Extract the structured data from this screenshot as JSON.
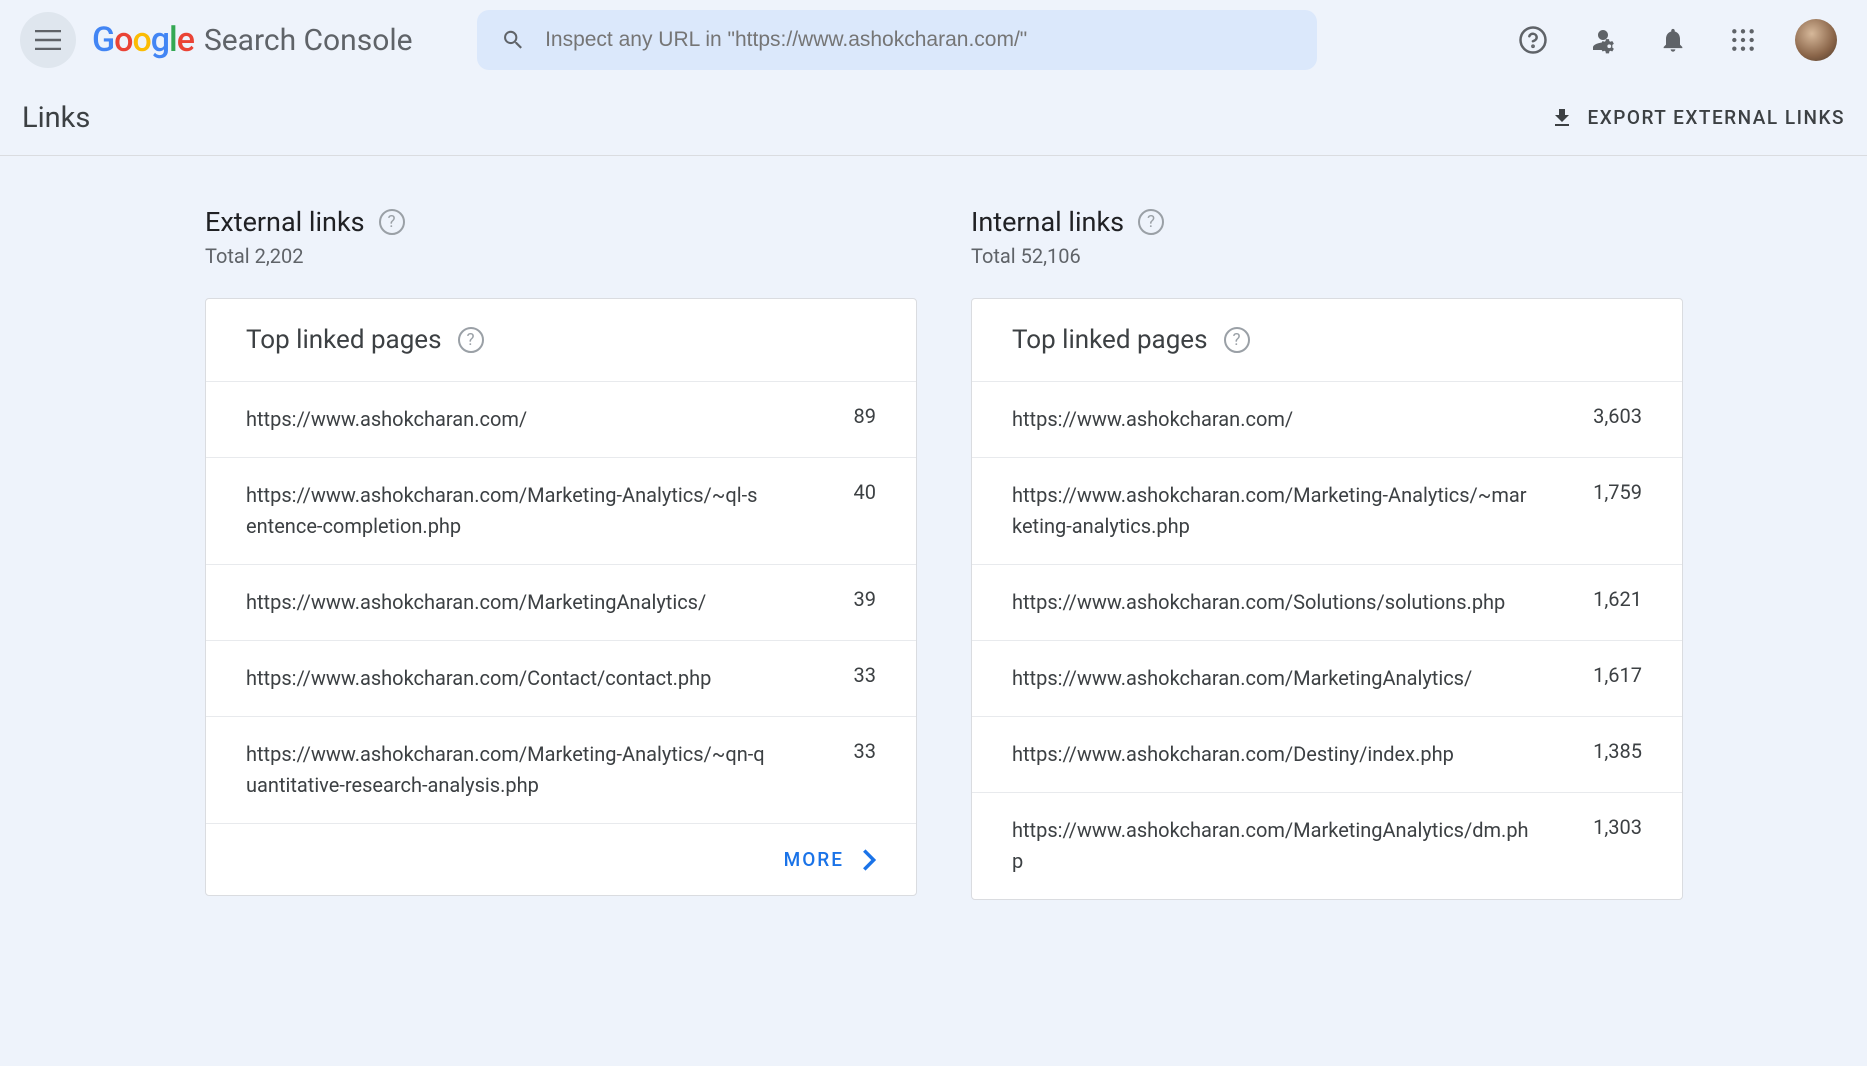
{
  "app": {
    "logoText": "Search Console",
    "pageTitle": "Links",
    "exportLabel": "EXPORT EXTERNAL LINKS"
  },
  "search": {
    "placeholder": "Inspect any URL in \"https://www.ashokcharan.com/\""
  },
  "external": {
    "title": "External links",
    "totalLabel": "Total 2,202",
    "cardTitle": "Top linked pages",
    "moreLabel": "MORE",
    "rows": [
      {
        "url": "https://www.ashokcharan.com/",
        "count": "89"
      },
      {
        "url": "https://www.ashokcharan.com/Marketing-Analytics/~ql-sentence-completion.php",
        "count": "40"
      },
      {
        "url": "https://www.ashokcharan.com/MarketingAnalytics/",
        "count": "39"
      },
      {
        "url": "https://www.ashokcharan.com/Contact/contact.php",
        "count": "33"
      },
      {
        "url": "https://www.ashokcharan.com/Marketing-Analytics/~qn-quantitative-research-analysis.php",
        "count": "33"
      }
    ]
  },
  "internal": {
    "title": "Internal links",
    "totalLabel": "Total 52,106",
    "cardTitle": "Top linked pages",
    "rows": [
      {
        "url": "https://www.ashokcharan.com/",
        "count": "3,603"
      },
      {
        "url": "https://www.ashokcharan.com/Marketing-Analytics/~marketing-analytics.php",
        "count": "1,759"
      },
      {
        "url": "https://www.ashokcharan.com/Solutions/solutions.php",
        "count": "1,621"
      },
      {
        "url": "https://www.ashokcharan.com/MarketingAnalytics/",
        "count": "1,617"
      },
      {
        "url": "https://www.ashokcharan.com/Destiny/index.php",
        "count": "1,385"
      },
      {
        "url": "https://www.ashokcharan.com/MarketingAnalytics/dm.php",
        "count": "1,303"
      }
    ]
  }
}
